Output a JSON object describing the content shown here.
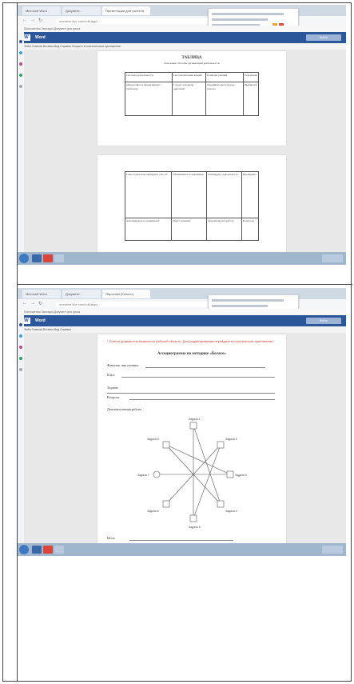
{
  "screenshot_1": {
    "tabs": [
      "Microsoft Word",
      "Документ...",
      "Презентация для учителя"
    ],
    "url": "onedrive.live.com/edit.aspx",
    "bookmarks": "Приложения  Закладки  Документ для урока",
    "app_name": "Word",
    "word_logo": "W",
    "signin": "Войти",
    "ribbon": "Файл  Главная  Вставка  Вид  Справка  Открыть в классическом приложении",
    "doc_title": "ТАБЛИЦА",
    "doc_subtitle": "Основные способы организации деятельности",
    "table_top": [
      [
        "Система деятельности",
        "Систематизация знаний",
        "Развитие умений",
        "Рефлексия"
      ],
      [
        "Определяют и формулируют проблему",
        "Строят алгоритм действий",
        "Оценивают результаты работы",
        "Выбирают"
      ]
    ],
    "table_bottom": [
      [
        "Самостоятельно выбирают способ",
        "Обмениваются мнениями",
        "Планируют деятельность",
        "Проверяют"
      ],
      [
        "Анализируют и сравнивают",
        "Ищут решение",
        "Корректируют работу",
        "Контроль"
      ]
    ]
  },
  "screenshot_2": {
    "tabs": [
      "Microsoft Word",
      "Документ...",
      "Опросник (Колесо)"
    ],
    "url": "onedrive.live.com/edit.aspx",
    "bookmarks": "Приложения  Закладки  Документ для урока",
    "app_name": "Word",
    "word_logo": "W",
    "signin": "Войти",
    "ribbon": "Файл  Главная  Вставка  Вид  Справка",
    "red_note": "* Список документов появится в рабочей области. Для редактирования перейдите в классическое приложение.",
    "doc_title": "Ассоциограмма по методике «Колесо»",
    "fields": [
      "Фамилия, имя ученика",
      "Класс",
      "Задание",
      "Вопросы",
      "Дата выполнения работы",
      "Итого"
    ],
    "diagram_labels": [
      "Задача 1",
      "Задача 2",
      "Задача 3",
      "Задача 4",
      "Задача 5",
      "Задача 6",
      "Задача 7",
      "Задача 8"
    ]
  },
  "colors": {
    "word_blue": "#2b579a",
    "taskbar": "#9fb6cc",
    "alert_red": "#d43a2a"
  }
}
